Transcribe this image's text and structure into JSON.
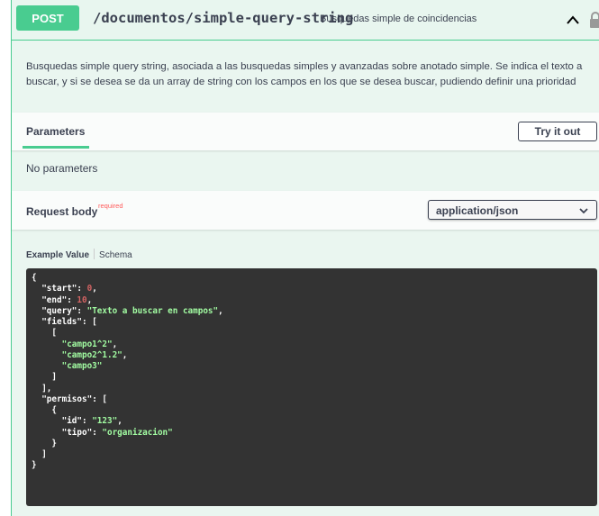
{
  "operation": {
    "method": "POST",
    "path": "/documentos/simple-query-string",
    "summary": "Busquedas simple de coincidencias",
    "description": "Busquedas simple query string, asociada a las busquedas simples y avanzadas sobre anotado simple. Se indica el texto a buscar, y si se desea se da un array de string con los campos en los que se desea buscar, pudiendo definir una prioridad",
    "icons": {
      "collapse": "chevron-up-icon",
      "auth": "lock-icon"
    }
  },
  "parameters": {
    "tab_label": "Parameters",
    "try_it_out": "Try it out",
    "empty_text": "No parameters"
  },
  "request_body": {
    "title": "Request body",
    "required_label": "required",
    "content_type": "application/json",
    "example_tab": "Example Value",
    "schema_tab": "Schema"
  },
  "example_json": [
    {
      "t": "{"
    },
    {
      "t": "  ",
      "k": "\"start\"",
      "p": ": ",
      "v": "0",
      "vt": "n",
      "e": ","
    },
    {
      "t": "  ",
      "k": "\"end\"",
      "p": ": ",
      "v": "10",
      "vt": "n",
      "e": ","
    },
    {
      "t": "  ",
      "k": "\"query\"",
      "p": ": ",
      "v": "\"Texto a buscar en campos\"",
      "vt": "s",
      "e": ","
    },
    {
      "t": "  ",
      "k": "\"fields\"",
      "p": ": [",
      "v": "",
      "vt": "s",
      "e": ""
    },
    {
      "t": "    ["
    },
    {
      "t": "      ",
      "k": "",
      "p": "",
      "v": "\"campo1^2\"",
      "vt": "s",
      "e": ","
    },
    {
      "t": "      ",
      "k": "",
      "p": "",
      "v": "\"campo2^1.2\"",
      "vt": "s",
      "e": ","
    },
    {
      "t": "      ",
      "k": "",
      "p": "",
      "v": "\"campo3\"",
      "vt": "s",
      "e": ""
    },
    {
      "t": "    ]"
    },
    {
      "t": "  ],"
    },
    {
      "t": "  ",
      "k": "\"permisos\"",
      "p": ": [",
      "v": "",
      "vt": "s",
      "e": ""
    },
    {
      "t": "    {"
    },
    {
      "t": "      ",
      "k": "\"id\"",
      "p": ": ",
      "v": "\"123\"",
      "vt": "s",
      "e": ","
    },
    {
      "t": "      ",
      "k": "\"tipo\"",
      "p": ": ",
      "v": "\"organizacion\"",
      "vt": "s",
      "e": ""
    },
    {
      "t": "    }"
    },
    {
      "t": "  ]"
    },
    {
      "t": "}"
    }
  ],
  "colors": {
    "post_green": "#49cc90",
    "block_bg": "#eaf6f0",
    "code_bg": "#333333",
    "code_string": "#a2fca2",
    "code_number": "#d36363",
    "required_red": "#ff5b5b"
  }
}
